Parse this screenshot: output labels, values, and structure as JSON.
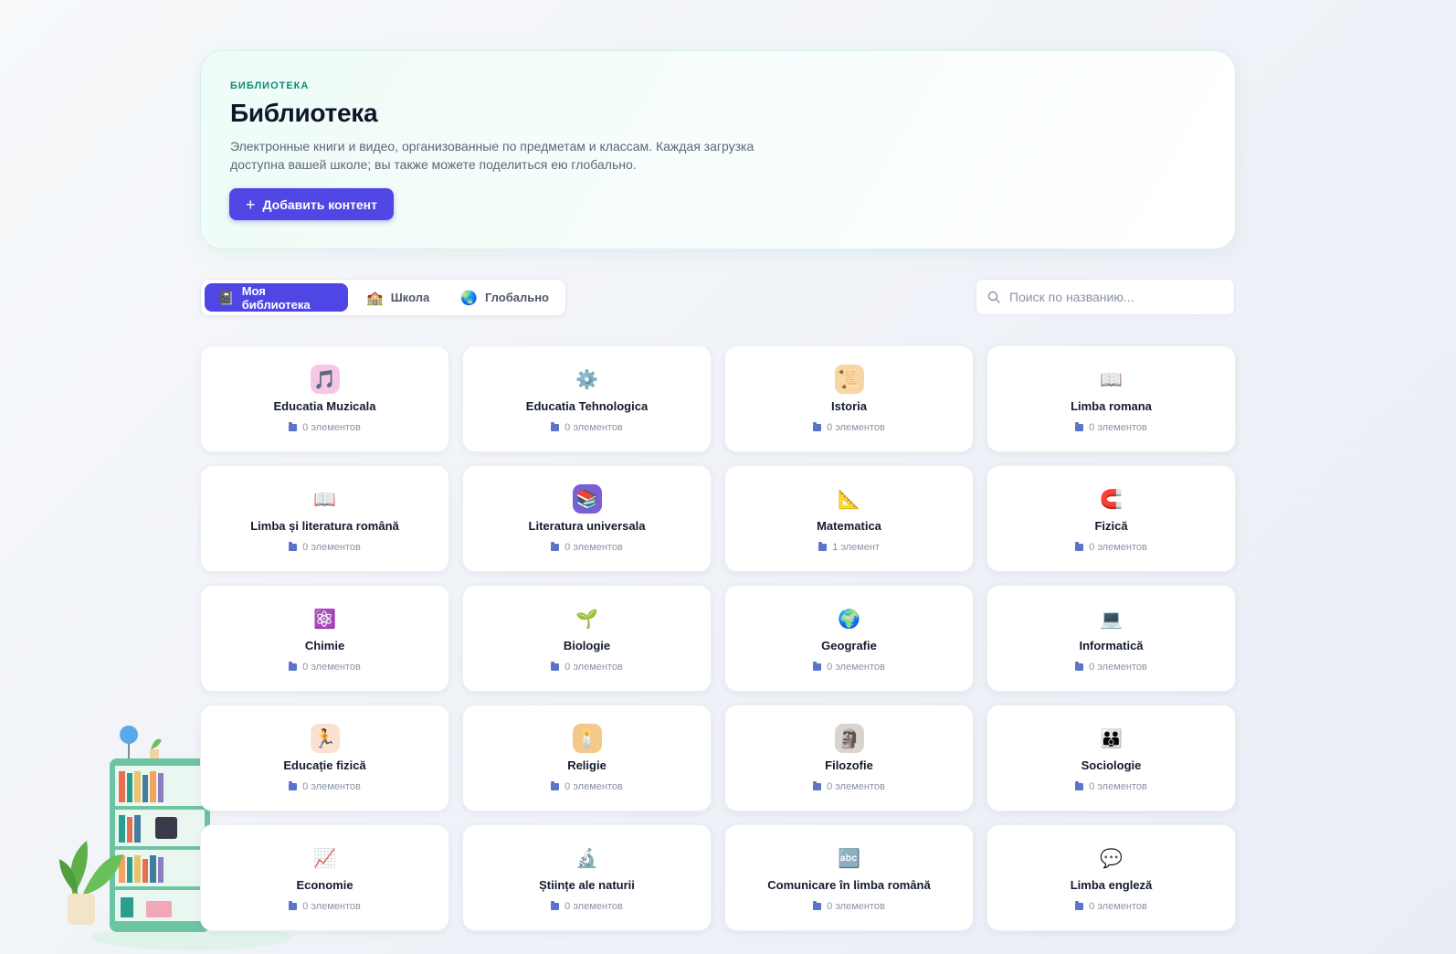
{
  "hero": {
    "kicker": "БИБЛИОТЕКА",
    "title": "Библиотека",
    "description": "Электронные книги и видео, организованные по предметам и классам. Каждая загрузка доступна вашей школе; вы также можете поделиться ею глобально.",
    "add_button_label": "Добавить контент"
  },
  "tabs": [
    {
      "label": "Моя библиотека",
      "icon": "📓",
      "active": true
    },
    {
      "label": "Школа",
      "icon": "🏫",
      "active": false
    },
    {
      "label": "Глобально",
      "icon": "🌏",
      "active": false
    }
  ],
  "search": {
    "placeholder": "Поиск по названию..."
  },
  "subjects": [
    {
      "title": "Educatia Muzicala",
      "count": "0 элементов",
      "icon": "🎵",
      "icon_bg": "#f7c6e6"
    },
    {
      "title": "Educatia Tehnologica",
      "count": "0 элементов",
      "icon": "⚙️",
      "icon_bg": "transparent"
    },
    {
      "title": "Istoria",
      "count": "0 элементов",
      "icon": "📜",
      "icon_bg": "#f5d6a4"
    },
    {
      "title": "Limba romana",
      "count": "0 элементов",
      "icon": "📖",
      "icon_bg": "transparent"
    },
    {
      "title": "Limba și literatura română",
      "count": "0 элементов",
      "icon": "📖",
      "icon_bg": "transparent"
    },
    {
      "title": "Literatura universala",
      "count": "0 элементов",
      "icon": "📚",
      "icon_bg": "#7b5fd6"
    },
    {
      "title": "Matematica",
      "count": "1 элемент",
      "icon": "📐",
      "icon_bg": "transparent"
    },
    {
      "title": "Fizică",
      "count": "0 элементов",
      "icon": "🧲",
      "icon_bg": "transparent"
    },
    {
      "title": "Chimie",
      "count": "0 элементов",
      "icon": "⚛️",
      "icon_bg": "transparent"
    },
    {
      "title": "Biologie",
      "count": "0 элементов",
      "icon": "🌱",
      "icon_bg": "transparent"
    },
    {
      "title": "Geografie",
      "count": "0 элементов",
      "icon": "🌍",
      "icon_bg": "transparent"
    },
    {
      "title": "Informatică",
      "count": "0 элементов",
      "icon": "💻",
      "icon_bg": "transparent"
    },
    {
      "title": "Educație fizică",
      "count": "0 элементов",
      "icon": "🏃",
      "icon_bg": "#fbe1cf"
    },
    {
      "title": "Religie",
      "count": "0 элементов",
      "icon": "🕯️",
      "icon_bg": "#f3c98a"
    },
    {
      "title": "Filozofie",
      "count": "0 элементов",
      "icon": "🗿",
      "icon_bg": "#d9d4cc"
    },
    {
      "title": "Sociologie",
      "count": "0 элементов",
      "icon": "👪",
      "icon_bg": "transparent"
    },
    {
      "title": "Economie",
      "count": "0 элементов",
      "icon": "📈",
      "icon_bg": "transparent"
    },
    {
      "title": "Științe ale naturii",
      "count": "0 элементов",
      "icon": "🔬",
      "icon_bg": "transparent"
    },
    {
      "title": "Comunicare în limba română",
      "count": "0 элементов",
      "icon": "🔤",
      "icon_bg": "transparent"
    },
    {
      "title": "Limba engleză",
      "count": "0 элементов",
      "icon": "💬",
      "icon_bg": "transparent"
    }
  ],
  "colors": {
    "accent": "#4f46e5",
    "kicker": "#0e8a76"
  }
}
